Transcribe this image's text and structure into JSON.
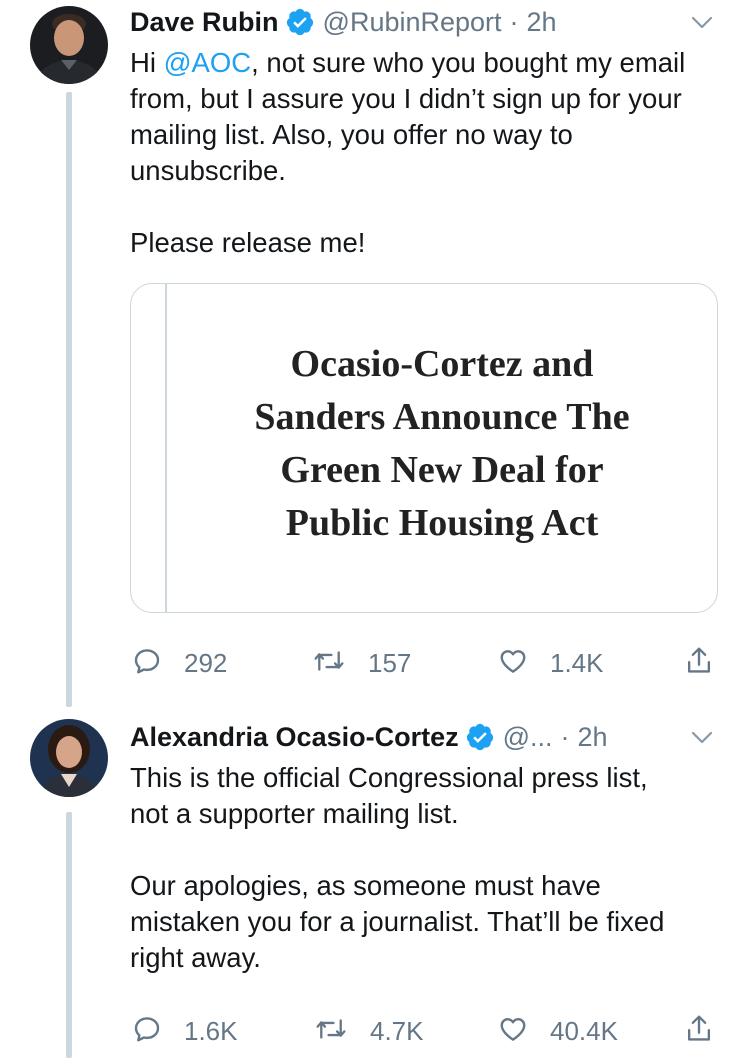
{
  "tweets": [
    {
      "name": "Dave Rubin",
      "verified": true,
      "handle": "@RubinReport",
      "separator": "·",
      "time": "2h",
      "text_prefix": "Hi ",
      "mention": "@AOC",
      "text_suffix": ", not sure who you bought my email\nfrom, but I assure you I didn’t sign up for your\nmailing list. Also, you offer no way to\nunsubscribe.\n\nPlease release me!",
      "card": {
        "title": "Ocasio-Cortez and\nSanders Announce The\nGreen New Deal for\nPublic Housing Act"
      },
      "replies": "292",
      "retweets": "157",
      "likes": "1.4K",
      "icons": [
        "reply-icon",
        "retweet-icon",
        "like-icon",
        "share-icon",
        "chevron-down-icon",
        "verified-badge-icon"
      ]
    },
    {
      "name": "Alexandria Ocasio-Cortez",
      "verified": true,
      "handle": "@...",
      "separator": "·",
      "time": "2h",
      "text": "This is the official Congressional press list,\nnot a supporter mailing list.\n\nOur apologies, as someone must have\nmistaken you for a journalist. That’ll be fixed\nright away.",
      "replies": "1.6K",
      "retweets": "4.7K",
      "likes": "40.4K",
      "icons": [
        "reply-icon",
        "retweet-icon",
        "like-icon",
        "share-icon",
        "chevron-down-icon",
        "verified-badge-icon"
      ]
    }
  ],
  "colors": {
    "accent": "#1da1f2",
    "secondary_text": "#657786",
    "thread_line": "#ccd6dd",
    "verified": "#1da1f2"
  }
}
